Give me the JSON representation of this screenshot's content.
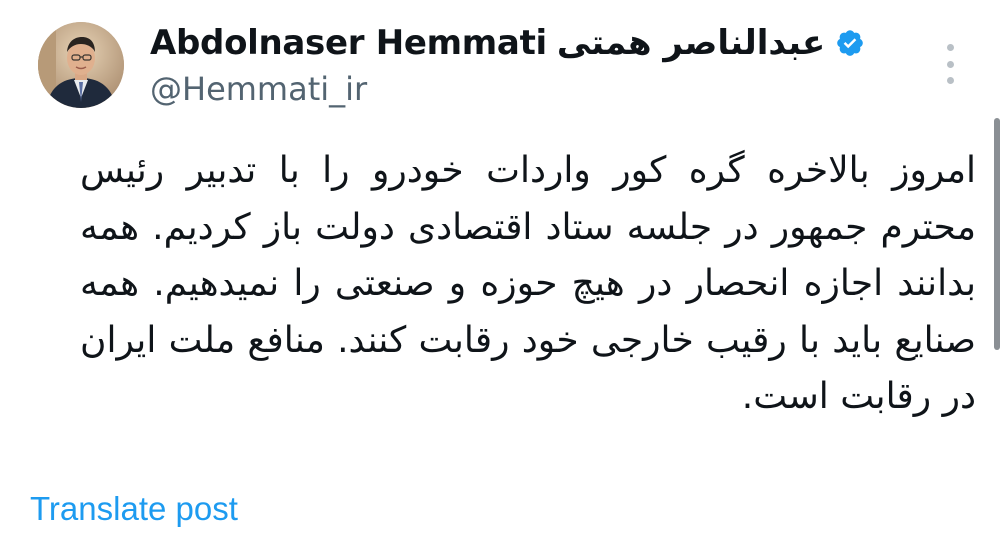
{
  "post": {
    "author": {
      "display_name": "Abdolnaser Hemmati",
      "display_name_fa": "عبدالناصر همتی",
      "handle": "@Hemmati_ir",
      "verified": true,
      "verified_color": "#1d9bf0"
    },
    "text": "امروز بالاخره گره کور واردات خودرو را با تدبیر رئیس محترم جمهور در جلسه ستاد اقتصادی دولت باز کردیم. همه بدانند اجازه انحصار در هیچ حوزه و صنعتی را نمیدهیم. همه صنایع باید با رقیب خارجی خود رقابت کنند. منافع ملت ایران در رقابت است.",
    "translate_label": "Translate post"
  },
  "icons": {
    "more": "more-vertical-icon",
    "verified": "verified-badge-icon"
  },
  "colors": {
    "link": "#1d9bf0",
    "text": "#0f1419",
    "secondary": "#536471"
  }
}
